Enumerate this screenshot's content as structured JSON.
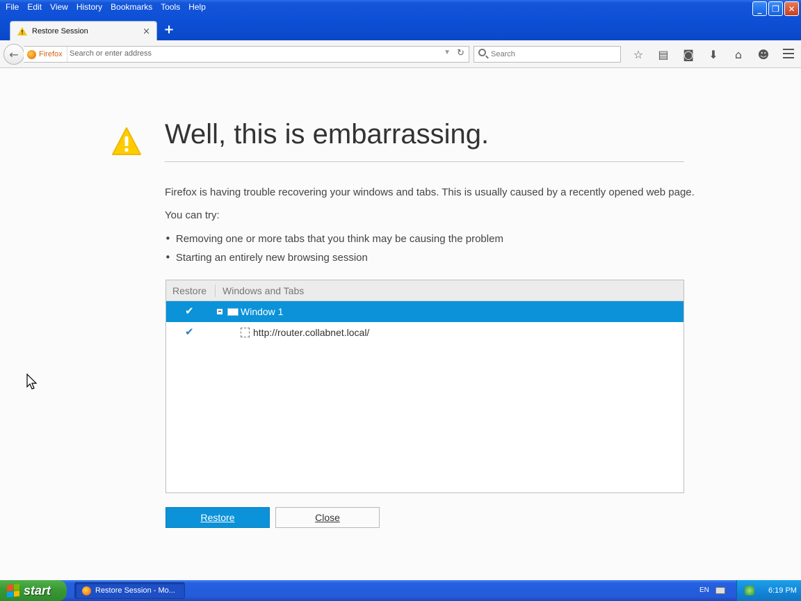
{
  "menu": [
    "File",
    "Edit",
    "View",
    "History",
    "Bookmarks",
    "Tools",
    "Help"
  ],
  "window_controls": [
    "minimize-icon",
    "restore-icon",
    "close-icon"
  ],
  "tab": {
    "title": "Restore Session",
    "icon": "warning-icon",
    "close": "×",
    "new_tab": "+"
  },
  "navbar": {
    "identity_label": "Firefox",
    "url_placeholder": "Search or enter address",
    "search_placeholder": "Search",
    "toolbar_icons": [
      "star-icon",
      "reading-list-icon",
      "pocket-icon",
      "download-icon",
      "home-icon",
      "hello-icon",
      "menu-icon"
    ]
  },
  "page": {
    "title": "Well, this is embarrassing.",
    "description": "Firefox is having trouble recovering your windows and tabs. This is usually caused by a recently opened web page.",
    "try_label": "You can try:",
    "suggestions": [
      "Removing one or more tabs that you think may be causing the problem",
      "Starting an entirely new browsing session"
    ],
    "tree": {
      "col_restore": "Restore",
      "col_windows": "Windows and Tabs",
      "rows": [
        {
          "label": "Window 1",
          "checked": true,
          "selected": true,
          "type": "window"
        },
        {
          "label": "http://router.collabnet.local/",
          "checked": true,
          "selected": false,
          "type": "tab"
        }
      ]
    },
    "restore_button": "Restore",
    "close_button": "Close",
    "accent_color": "#0b92d8",
    "warning_color": "#ffcc00"
  },
  "taskbar": {
    "start_label": "start",
    "task_item": "Restore Session - Mo...",
    "language": "EN",
    "clock": "6:19 PM"
  }
}
